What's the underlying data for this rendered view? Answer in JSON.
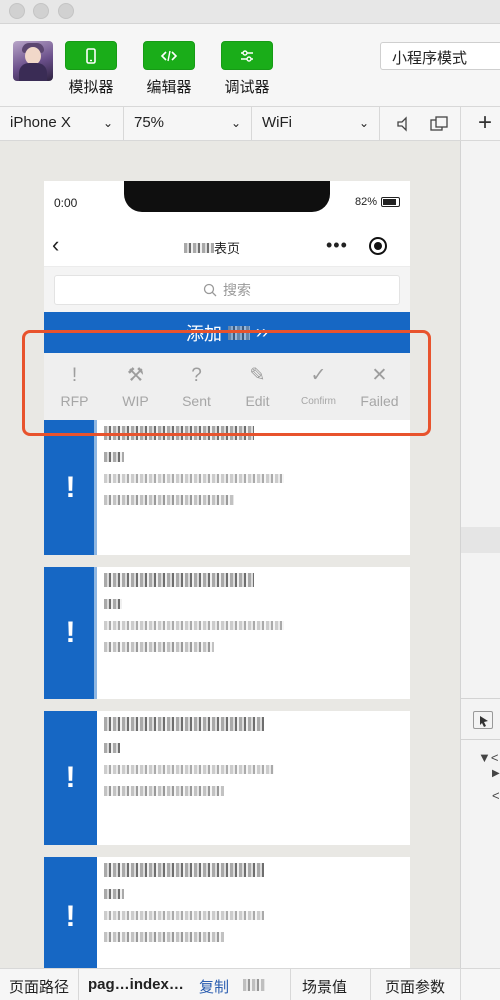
{
  "toolbar": {
    "simulator_label": "模拟器",
    "editor_label": "编辑器",
    "debugger_label": "调试器",
    "mode_value": "小程序模式"
  },
  "devicebar": {
    "device": "iPhone X",
    "zoom": "75%",
    "network": "WiFi"
  },
  "phone": {
    "status_time": "0:00",
    "battery": "82%",
    "nav_title_suffix": "表页",
    "search_placeholder": "搜索",
    "add_label": "添加",
    "filters": [
      {
        "icon": "!",
        "label": "RFP"
      },
      {
        "icon": "⚒",
        "label": "WIP"
      },
      {
        "icon": "?",
        "label": "Sent"
      },
      {
        "icon": "✎",
        "label": "Edit"
      },
      {
        "icon": "✓",
        "label": "Confirm"
      },
      {
        "icon": "✕",
        "label": "Failed"
      }
    ],
    "card_status_icon": "!"
  },
  "statusbar": {
    "page_path_label": "页面路径",
    "page_path_value": "pag…index…",
    "copy_label": "复制",
    "scene_label": "场景值",
    "params_label": "页面参数"
  },
  "colors": {
    "accent": "#1aad19",
    "primary": "#1667c4",
    "highlight": "#e8532d"
  }
}
